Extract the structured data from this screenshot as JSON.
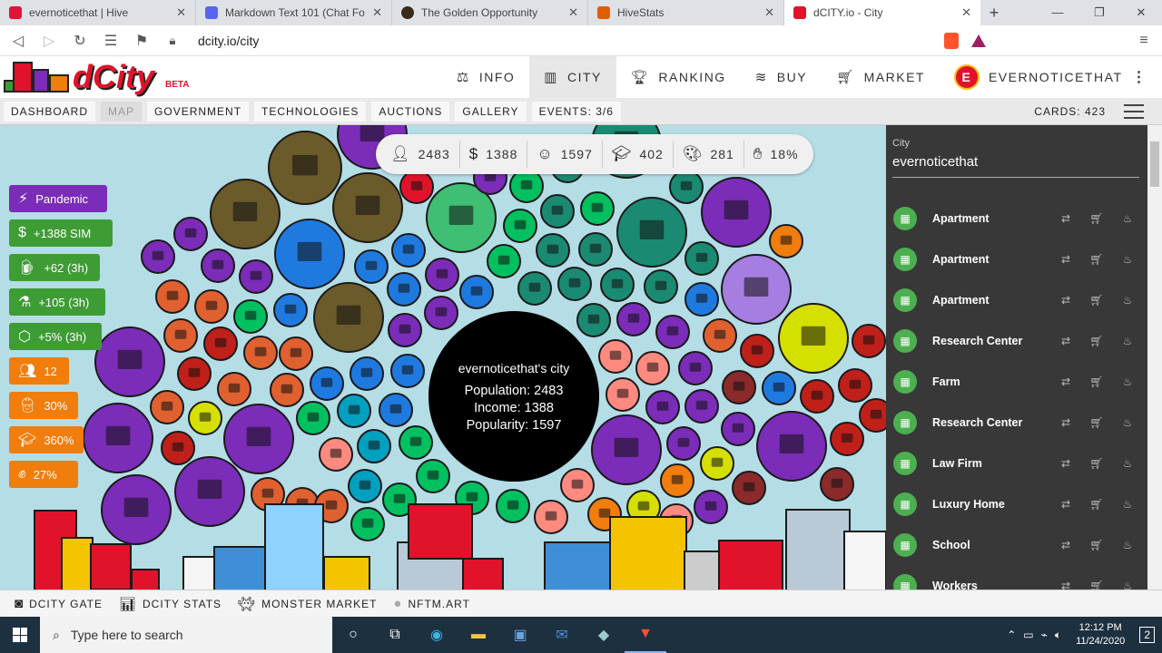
{
  "browser": {
    "tabs": [
      {
        "title": "evernoticethat | Hive",
        "color": "#e31337"
      },
      {
        "title": "Markdown Text 101 (Chat Formattin",
        "color": "#5865f2"
      },
      {
        "title": "The Golden Opportunity",
        "color": "#3a2a1a"
      },
      {
        "title": "HiveStats",
        "color": "#e05d00"
      },
      {
        "title": "dCITY.io - City",
        "color": "#e0132b"
      }
    ],
    "url": "dcity.io/city"
  },
  "header": {
    "logo": "dCity",
    "beta": "BETA",
    "menu": [
      {
        "label": "INFO",
        "icon": "scale-icon"
      },
      {
        "label": "CITY",
        "icon": "city-icon"
      },
      {
        "label": "RANKING",
        "icon": "trophy-icon"
      },
      {
        "label": "BUY",
        "icon": "coins-icon"
      },
      {
        "label": "MARKET",
        "icon": "cart-icon"
      }
    ],
    "user": "EVERNOTICETHAT",
    "avatar": "E"
  },
  "subnav": {
    "items": [
      "DASHBOARD",
      "MAP",
      "GOVERNMENT",
      "TECHNOLOGIES",
      "AUCTIONS",
      "GALLERY",
      "EVENTS: 3/6"
    ],
    "cards": "CARDS: 423"
  },
  "stats": [
    {
      "icon": "person-icon",
      "value": "2483"
    },
    {
      "icon": "dollar-icon",
      "value": "1388"
    },
    {
      "icon": "smile-icon",
      "value": "1597"
    },
    {
      "icon": "graduation-icon",
      "value": "402"
    },
    {
      "icon": "palette-icon",
      "value": "281"
    },
    {
      "icon": "tax-hand-icon",
      "value": "18%"
    }
  ],
  "side_buttons": [
    {
      "label": "Pandemic",
      "color": "#7b2cb8",
      "icon": "bolt-icon"
    },
    {
      "label": "+1388 SIM",
      "color": "#3e9c35",
      "icon": "dollar-icon"
    },
    {
      "label": "+62 (3h)",
      "color": "#3e9c35",
      "icon": "beer-icon"
    },
    {
      "label": "+105 (3h)",
      "color": "#3e9c35",
      "icon": "flask-icon"
    },
    {
      "label": "+5% (3h)",
      "color": "#3e9c35",
      "icon": "dice-icon"
    },
    {
      "label": "12",
      "color": "#f07d0c",
      "icon": "users-icon"
    },
    {
      "label": "30%",
      "color": "#f07d0c",
      "icon": "worker-icon"
    },
    {
      "label": "360%",
      "color": "#f07d0c",
      "icon": "graduation-icon"
    },
    {
      "label": "27%",
      "color": "#f07d0c",
      "icon": "fist-icon"
    }
  ],
  "center": {
    "name": "evernoticethat's city",
    "population": "Population: 2483",
    "income": "Income: 1388",
    "popularity": "Popularity: 1597"
  },
  "panel": {
    "label": "City",
    "value": "evernoticethat",
    "items": [
      "Apartment",
      "Apartment",
      "Apartment",
      "Research Center",
      "Farm",
      "Research Center",
      "Law Firm",
      "Luxury Home",
      "School",
      "Workers"
    ]
  },
  "links": [
    "DCITY GATE",
    "DCITY STATS",
    "MONSTER MARKET",
    "NFTM.ART"
  ],
  "taskbar": {
    "search_placeholder": "Type here to search",
    "time": "12:12 PM",
    "date": "11/24/2020",
    "notifications": "2"
  }
}
